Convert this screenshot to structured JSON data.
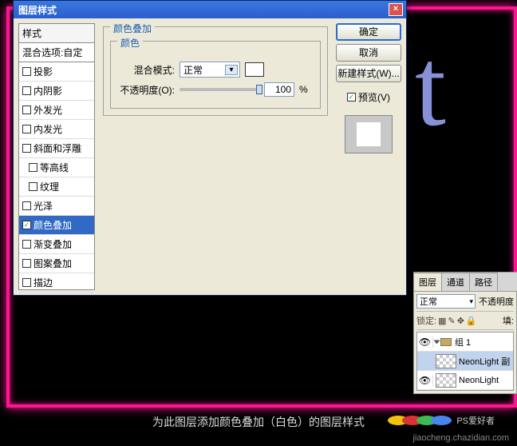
{
  "dialog": {
    "title": "图层样式",
    "close": "×",
    "styles_header": "样式",
    "blend_options_row": "混合选项:自定",
    "effects": [
      {
        "label": "投影",
        "checked": false
      },
      {
        "label": "内阴影",
        "checked": false
      },
      {
        "label": "外发光",
        "checked": false
      },
      {
        "label": "内发光",
        "checked": false
      },
      {
        "label": "斜面和浮雕",
        "checked": false
      },
      {
        "label": "等高线",
        "checked": false,
        "indent": true
      },
      {
        "label": "纹理",
        "checked": false,
        "indent": true
      },
      {
        "label": "光泽",
        "checked": false
      },
      {
        "label": "颜色叠加",
        "checked": true,
        "selected": true
      },
      {
        "label": "渐变叠加",
        "checked": false
      },
      {
        "label": "图案叠加",
        "checked": false
      },
      {
        "label": "描边",
        "checked": false
      }
    ],
    "section_title": "颜色叠加",
    "inner_section_title": "颜色",
    "blend_mode_label": "混合模式:",
    "blend_mode_value": "正常",
    "opacity_label": "不透明度(O):",
    "opacity_value": "100",
    "opacity_unit": "%",
    "buttons": {
      "ok": "确定",
      "cancel": "取消",
      "new_style": "新建样式(W)..."
    },
    "preview_label": "预览(V)"
  },
  "layers_panel": {
    "tabs": [
      "图层",
      "通道",
      "路径"
    ],
    "blend_mode": "正常",
    "opacity_label": "不透明度",
    "lock_label": "锁定:",
    "fill_label": "填:",
    "group_name": "组 1",
    "layer1": "NeonLight 副",
    "layer2": "NeonLight"
  },
  "canvas_glyph": "t",
  "caption": "为此图层添加颜色叠加（白色）的图层样式",
  "watermark_label": "PS爱好者",
  "watermark_url": "jiaocheng.chazidian.com"
}
